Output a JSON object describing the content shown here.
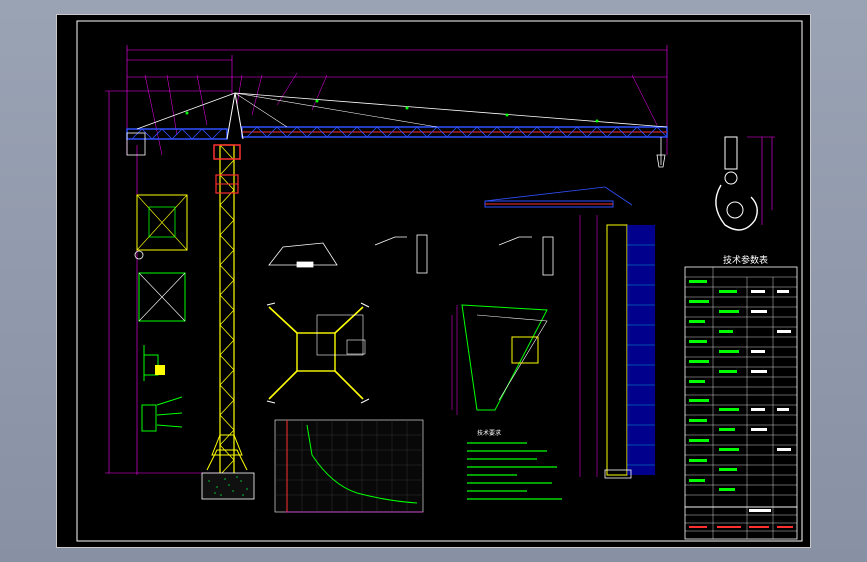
{
  "titles": {
    "main_spec_table": "技术参数表",
    "tech_requirements": "技术要求"
  },
  "colors": {
    "background": "#000000",
    "page": "#8a94a6",
    "frame": "#ffffff",
    "tower": "#ffff00",
    "jib_blue": "#3050ff",
    "jib_red": "#ff3030",
    "dimension": "#ff00ff",
    "green": "#00ff00",
    "cyan": "#00ffff",
    "white": "#ffffff"
  }
}
